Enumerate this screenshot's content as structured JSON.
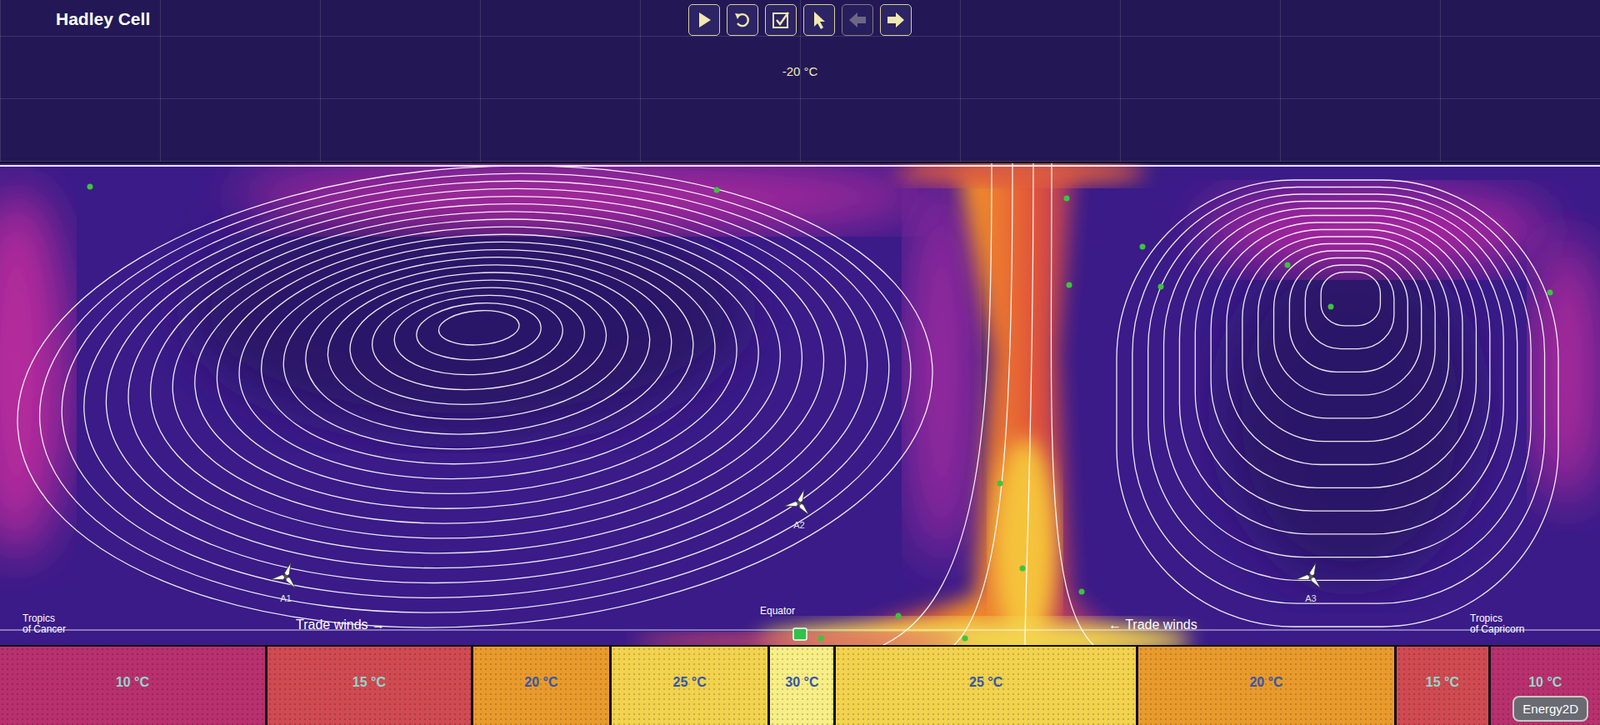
{
  "window": {
    "title": "Hadley Cell"
  },
  "toolbar": [
    {
      "kind": "play",
      "disabled": false
    },
    {
      "kind": "reset",
      "disabled": false
    },
    {
      "kind": "check",
      "disabled": false
    },
    {
      "kind": "pointer",
      "disabled": false
    },
    {
      "kind": "back",
      "disabled": true
    },
    {
      "kind": "forward",
      "disabled": false
    }
  ],
  "sky": {
    "temperature": "-20 °C"
  },
  "anemometers": [
    {
      "label": "A1"
    },
    {
      "label": "A2"
    },
    {
      "label": "A3"
    }
  ],
  "labels": {
    "trade_winds_left": "Trade winds →",
    "trade_winds_right": "← Trade winds",
    "equator": "Equator",
    "tropics_left": [
      "Tropics",
      "of Cancer"
    ],
    "tropics_right": [
      "Tropics",
      "of Capricorn"
    ]
  },
  "ground": [
    {
      "label": "10 °C",
      "color": "#b8306e"
    },
    {
      "label": "15 °C",
      "color": "#d04a52"
    },
    {
      "label": "20 °C",
      "color": "#e99a2c"
    },
    {
      "label": "25 °C",
      "color": "#f2d24e"
    },
    {
      "label": "30 °C",
      "color": "#f7ee86"
    },
    {
      "label": "25 °C",
      "color": "#f2d24e"
    },
    {
      "label": "20 °C",
      "color": "#e99a2c"
    },
    {
      "label": "15 °C",
      "color": "#d04a52"
    },
    {
      "label": "10 °C",
      "color": "#b8306e"
    }
  ],
  "badge": "Energy2D"
}
